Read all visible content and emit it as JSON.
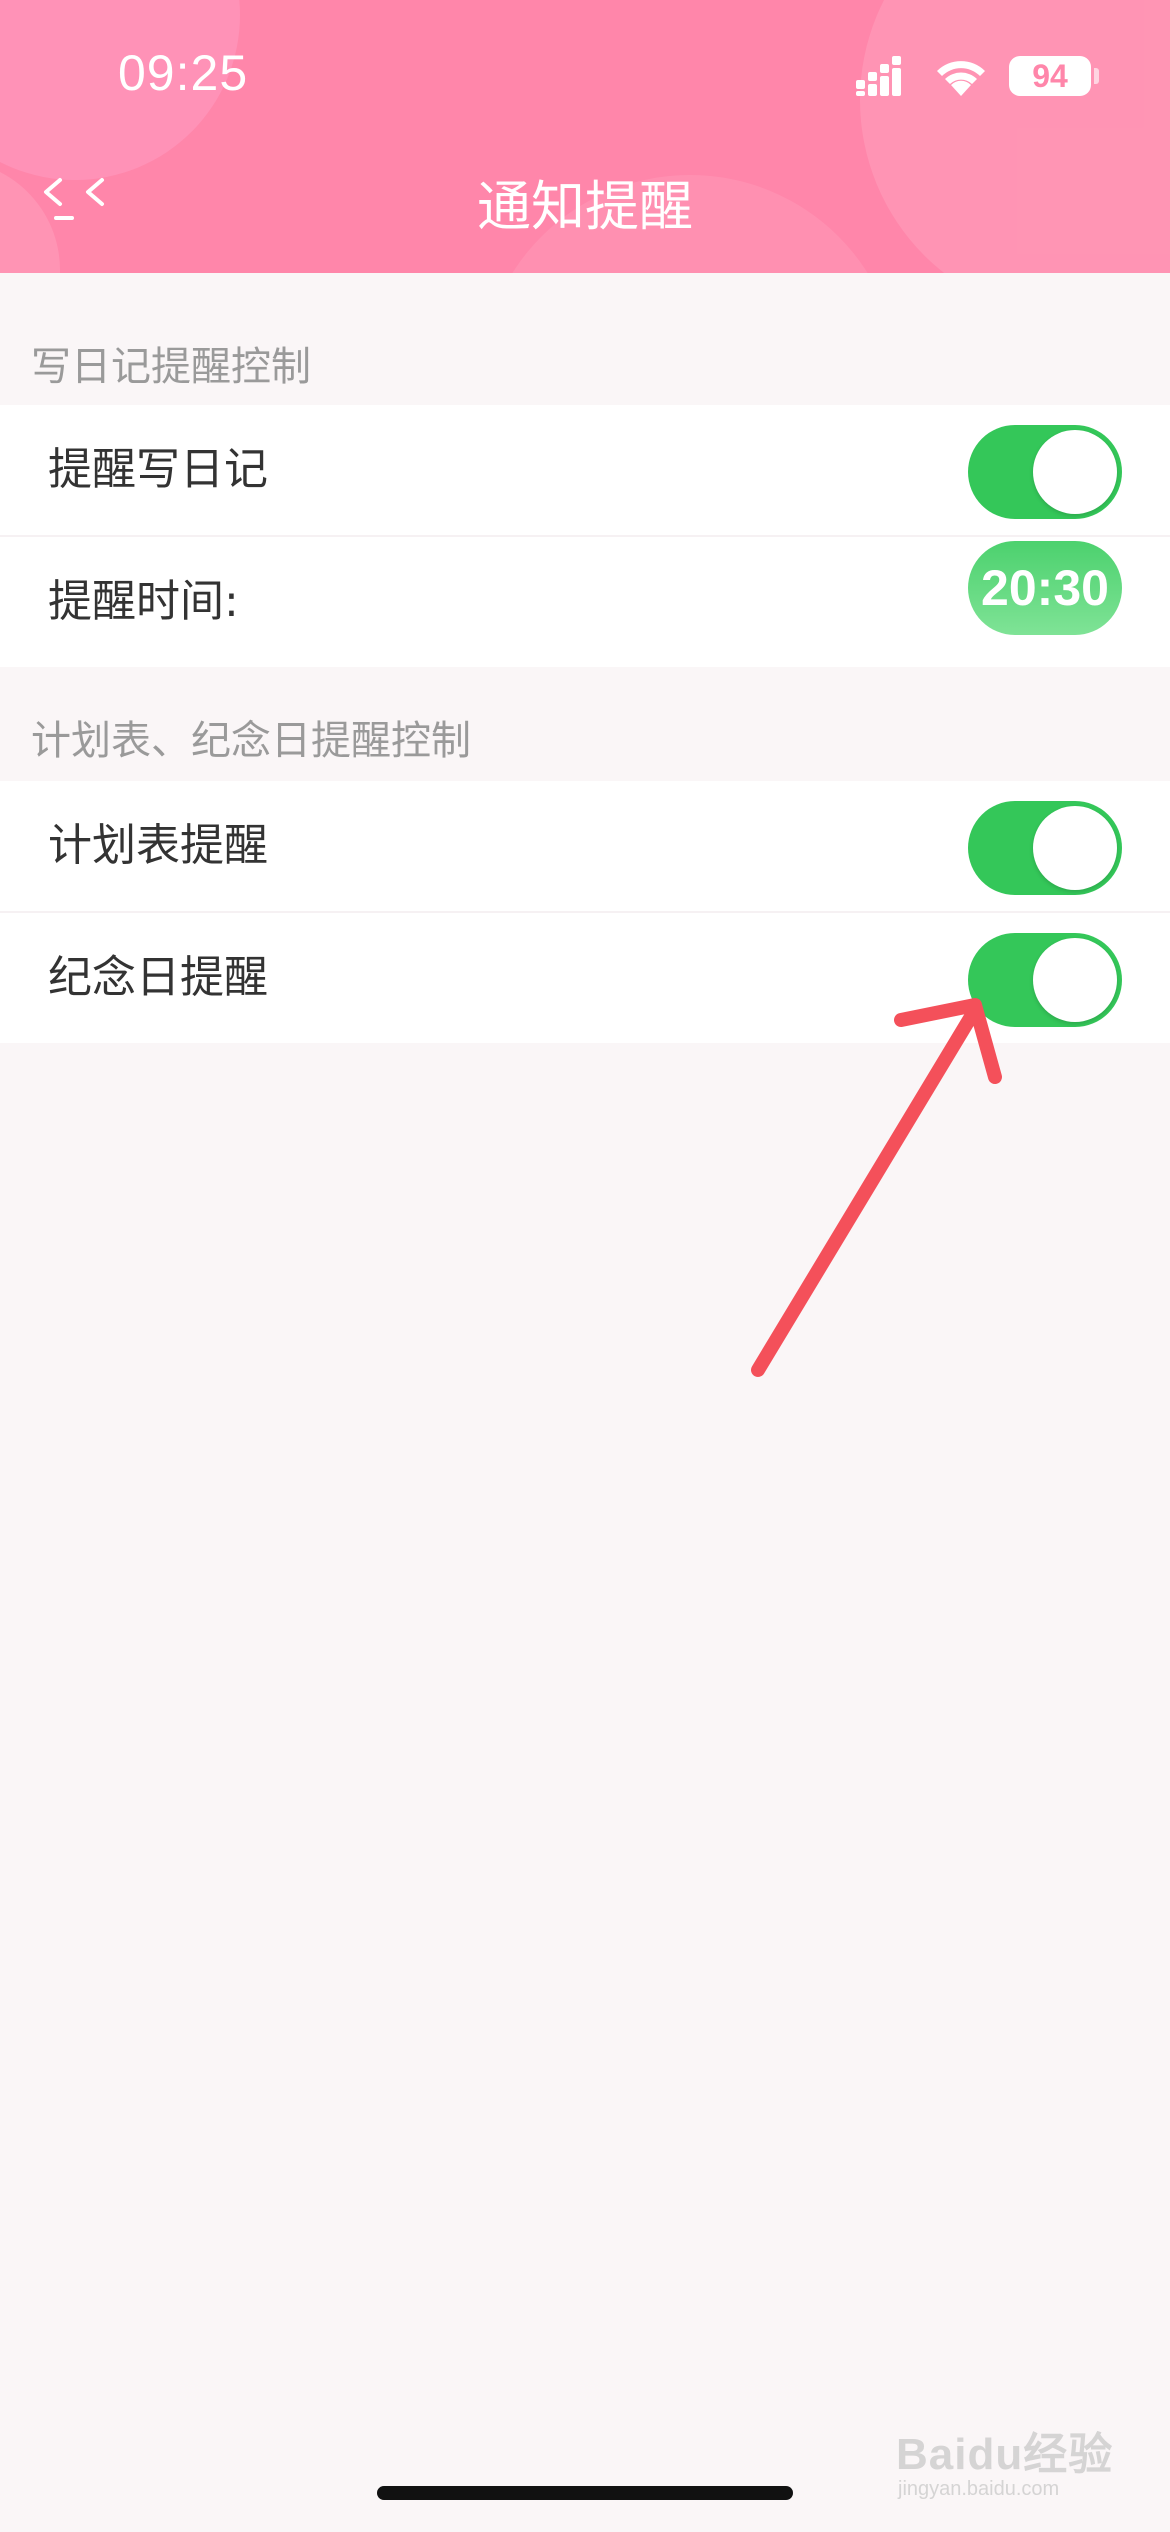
{
  "status_bar": {
    "time": "09:25",
    "battery": "94"
  },
  "header": {
    "back_icon": "double-chevron-left-icon",
    "title": "通知提醒"
  },
  "diary_section": {
    "title": "写日记提醒控制",
    "rows": [
      {
        "label": "提醒写日记",
        "toggle_on": true
      },
      {
        "label": "提醒时间:",
        "time_value": "20:30"
      }
    ]
  },
  "plan_section": {
    "title": "计划表、纪念日提醒控制",
    "rows": [
      {
        "label": "计划表提醒",
        "toggle_on": true
      },
      {
        "label": "纪念日提醒",
        "toggle_on": true
      }
    ]
  },
  "colors": {
    "header_pink": "#ff86aa",
    "toggle_green": "#34c759",
    "annotation_arrow": "#f4505a"
  },
  "watermark": {
    "brand": "Baidu经验",
    "domain": "jingyan.baidu.com"
  }
}
